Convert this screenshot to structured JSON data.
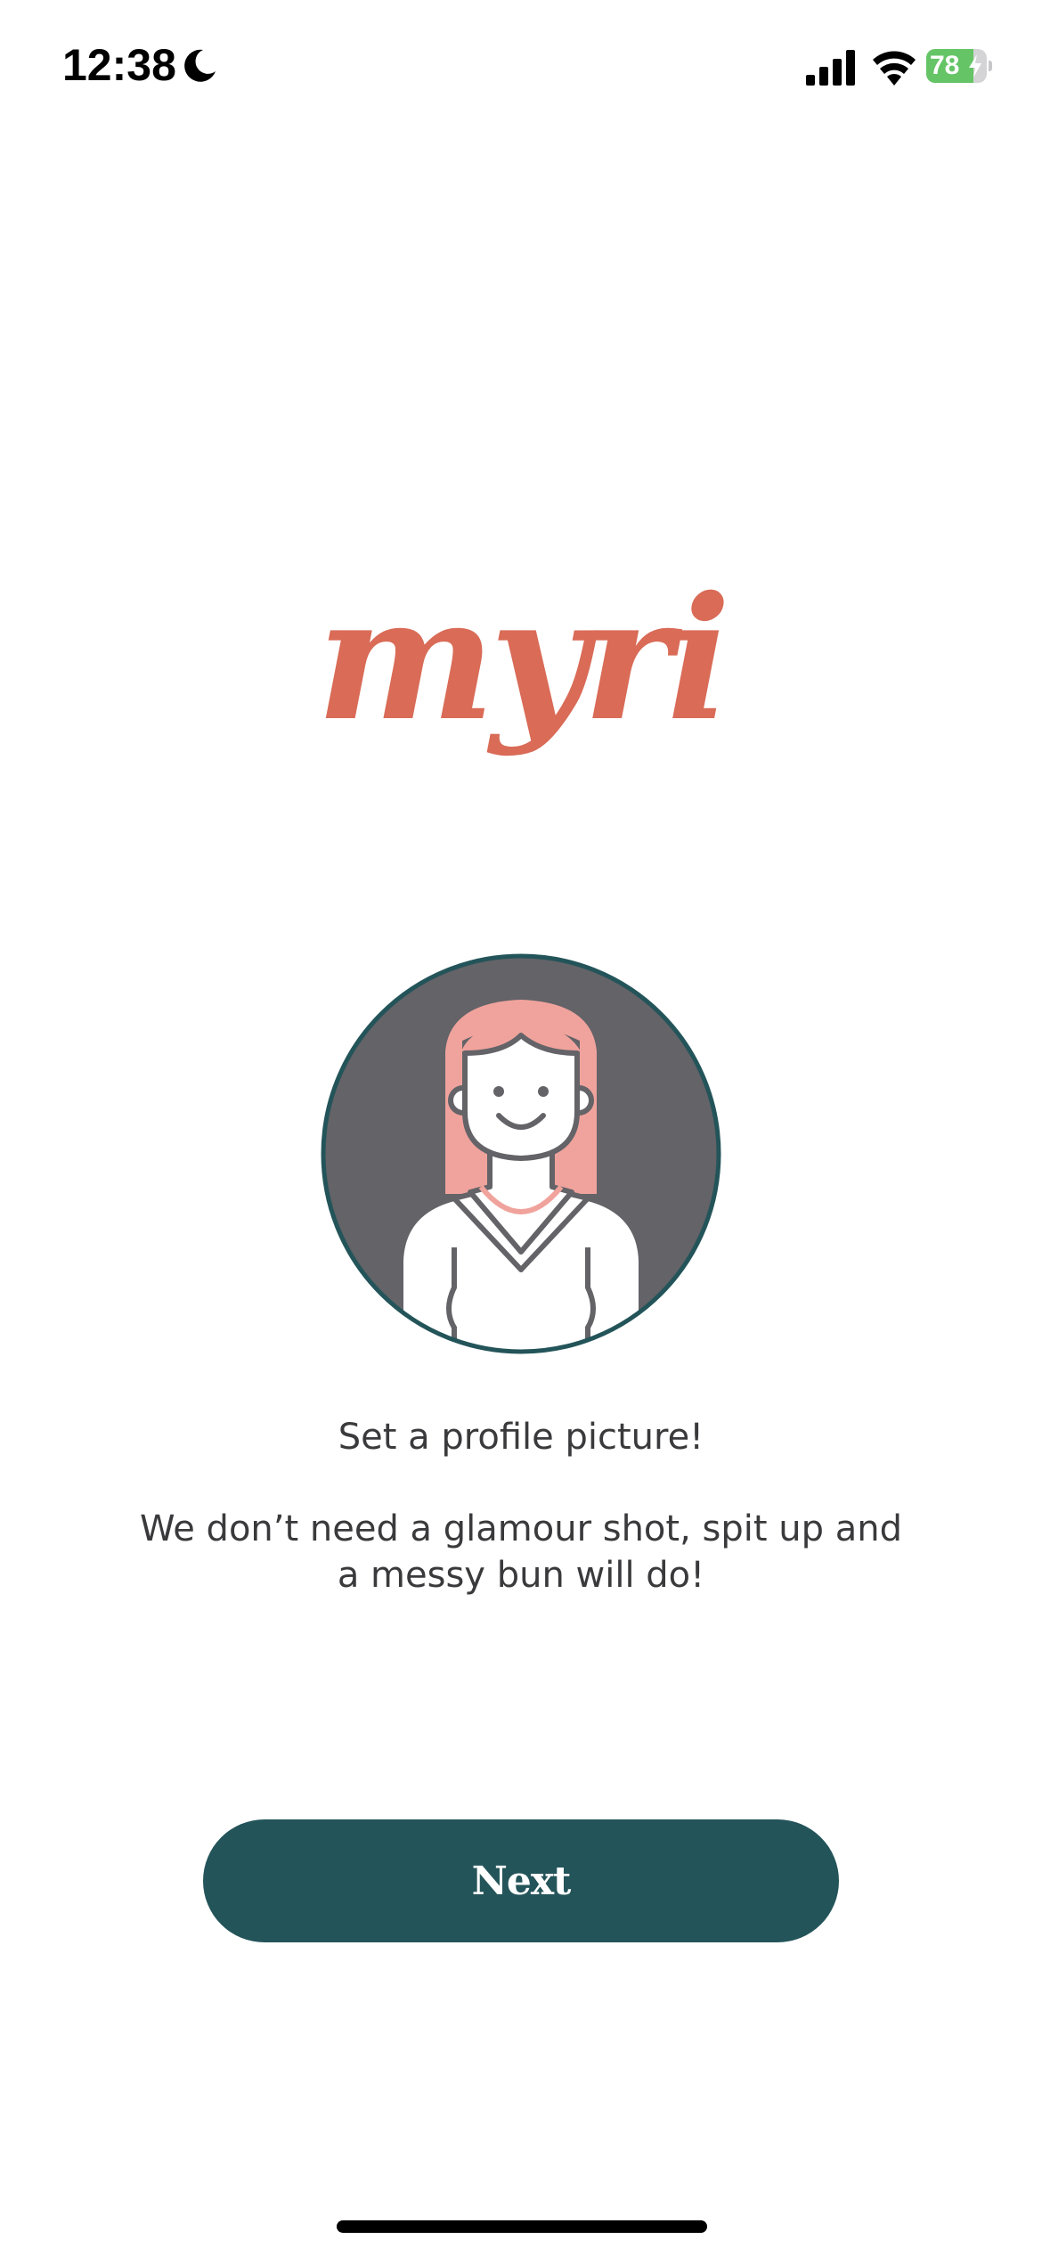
{
  "status_bar": {
    "time": "12:38",
    "battery_level": "78",
    "battery_fraction": 0.78,
    "icons": [
      "moon-icon",
      "signal-icon",
      "wifi-icon",
      "battery-icon",
      "charging-bolt-icon"
    ]
  },
  "logo": {
    "text": "myri"
  },
  "avatar": {
    "icon": "woman-avatar-icon"
  },
  "prompt": {
    "title": "Set a profile picture!",
    "body": "We don’t need a glamour shot, spit up and a messy bun will do!"
  },
  "actions": {
    "next_label": "Next"
  },
  "colors": {
    "brand": "#d96b57",
    "primary_button": "#235459",
    "text": "#3a3a3c",
    "avatar_background": "#636368",
    "avatar_hair": "#f0a39c",
    "avatar_ring": "#235459"
  }
}
